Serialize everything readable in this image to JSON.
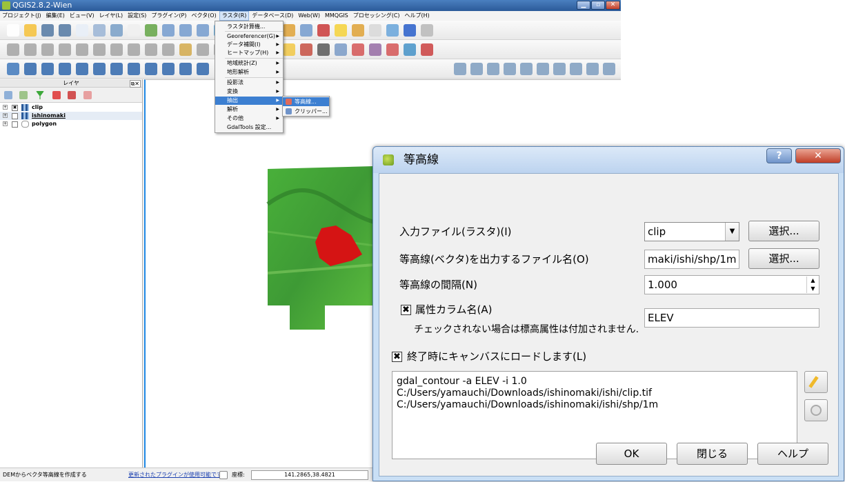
{
  "app": {
    "title": "QGIS2.8.2-Wien",
    "menubar": [
      "プロジェクト(J)",
      "編集(E)",
      "ビュー(V)",
      "レイヤ(L)",
      "設定(S)",
      "プラグイン(P)",
      "ベクタ(O)",
      "ラスタ(R)",
      "データベース(D)",
      "Web(W)",
      "MMQGIS",
      "プロセッシング(C)",
      "ヘルプ(H)"
    ],
    "menubar_active_index": 7
  },
  "raster_menu": {
    "items": [
      {
        "label": "ラスタ計算機...",
        "submenu": false
      },
      {
        "label": "Georeferencer(G)",
        "submenu": true
      },
      {
        "label": "データ補間(I)",
        "submenu": true
      },
      {
        "label": "ヒートマップ(H)",
        "submenu": true
      },
      {
        "label": "地域統計(Z)",
        "submenu": true
      },
      {
        "label": "地形解析",
        "submenu": true
      },
      {
        "label": "投影法",
        "submenu": true
      },
      {
        "label": "変換",
        "submenu": true
      },
      {
        "label": "抽出",
        "submenu": true,
        "highlighted": true
      },
      {
        "label": "解析",
        "submenu": true
      },
      {
        "label": "その他",
        "submenu": true
      },
      {
        "label": "GdalTools 設定...",
        "submenu": false
      }
    ],
    "extract_submenu": [
      {
        "label": "等高線...",
        "highlighted": true
      },
      {
        "label": "クリッパー..."
      }
    ]
  },
  "layers_panel": {
    "title": "レイヤ",
    "layers": [
      {
        "name": "clip",
        "checked": true,
        "type": "raster"
      },
      {
        "name": "ishinomaki",
        "checked": false,
        "type": "raster"
      },
      {
        "name": "polygon",
        "checked": false,
        "type": "polygon"
      }
    ]
  },
  "status": {
    "message": "DEMからベクタ等高線を作成する",
    "plugin_link": "更新されたプラグインが使用可能です",
    "coord_label": "座標:",
    "coord_value": "141.2865,38.4821"
  },
  "dialog": {
    "title": "等高線",
    "help_btn": "?",
    "close_btn": "✕",
    "input_label": "入力ファイル(ラスタ)(I)",
    "input_value": "clip",
    "select_btn": "選択...",
    "output_label": "等高線(ベクタ)を出力するファイル名(O)",
    "output_value": "maki/ishi/shp/1m",
    "interval_label": "等高線の間隔(N)",
    "interval_value": "1.000",
    "attr_label": "属性カラム名(A)",
    "attr_checked": true,
    "attr_value": "ELEV",
    "attr_note": "チェックされない場合は標高属性は付加されません.",
    "load_label": "終了時にキャンバスにロードします(L)",
    "load_checked": true,
    "command": "gdal_contour -a ELEV -i 1.0\nC:/Users/yamauchi/Downloads/ishinomaki/ishi/clip.tif\nC:/Users/yamauchi/Downloads/ishinomaki/ishi/shp/1m",
    "ok_btn": "OK",
    "close_text_btn": "閉じる",
    "help_text_btn": "ヘルプ"
  },
  "colors": {
    "dem_green": "#3fa033",
    "dem_red": "#d01010",
    "accent_blue": "#1e88e5"
  }
}
